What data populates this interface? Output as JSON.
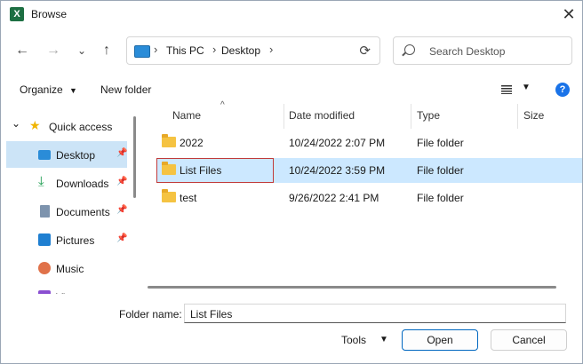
{
  "window": {
    "title": "Browse",
    "app_icon_letter": "X",
    "close_glyph": "✕"
  },
  "nav_buttons": {
    "back": "←",
    "forward": "→",
    "recent": "⌄",
    "up": "↑"
  },
  "address": {
    "crumbs": [
      "This PC",
      "Desktop"
    ],
    "separator": "›",
    "refresh_glyph": "⟳"
  },
  "search": {
    "placeholder": "Search Desktop"
  },
  "toolbar": {
    "organize": "Organize",
    "caret": "▼",
    "new_folder": "New folder",
    "help": "?"
  },
  "nav_pane": {
    "items": [
      {
        "label": "Quick access",
        "icon": "star-icon"
      },
      {
        "label": "Desktop",
        "icon": "desktop-icon",
        "pinned": true,
        "selected": true
      },
      {
        "label": "Downloads",
        "icon": "download-icon",
        "pinned": true
      },
      {
        "label": "Documents",
        "icon": "documents-icon",
        "pinned": true
      },
      {
        "label": "Pictures",
        "icon": "pictures-icon",
        "pinned": true
      },
      {
        "label": "Music",
        "icon": "music-icon"
      },
      {
        "label": "Vi",
        "icon": "videos-icon"
      }
    ],
    "expand_glyph": "⌄",
    "pin_glyph": "📌"
  },
  "file_list": {
    "columns": [
      "Name",
      "Date modified",
      "Type",
      "Size"
    ],
    "sort_glyph": "^",
    "rows": [
      {
        "name": "2022",
        "date": "10/24/2022 2:07 PM",
        "type": "File folder"
      },
      {
        "name": "List Files",
        "date": "10/24/2022 3:59 PM",
        "type": "File folder",
        "selected": true
      },
      {
        "name": "test",
        "date": "9/26/2022 2:41 PM",
        "type": "File folder"
      }
    ]
  },
  "footer": {
    "folder_name_label": "Folder name:",
    "folder_name_value": "List Files",
    "tools": "Tools",
    "open": "Open",
    "cancel": "Cancel"
  },
  "colors": {
    "selection": "#cce8ff",
    "accent": "#0067c0",
    "highlight_box": "#c13b3b"
  }
}
